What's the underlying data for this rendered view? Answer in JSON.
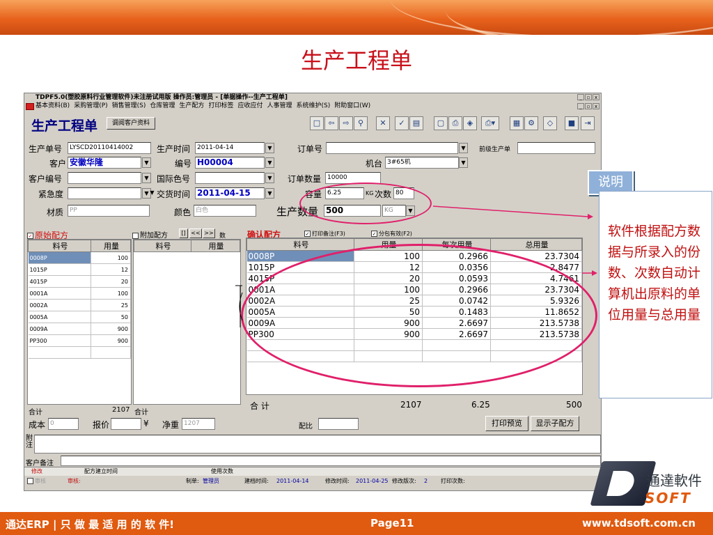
{
  "slide": {
    "title": "生产工程单",
    "footer_left": "通达ERP | 只 做 最 适 用 的 软 件!",
    "footer_page": "Page11",
    "footer_url": "www.tdsoft.com.cn",
    "logo_cn": "通達軟件",
    "logo_en": "SOFT",
    "note_tag": "说明",
    "note_text": "软件根据配方数据与所录入的份数、次数自动计算机出原料的单位用量与总用量",
    "color_accent": "#c8101a",
    "color_band": "#e05a0f"
  },
  "window": {
    "title": "TDPF5.0(塑胶原料行业管理软件)未注册试用版 操作员:管理员 - [单据操作--生产工程单]",
    "menus": [
      "基本资料(B)",
      "采购管理(P)",
      "销售管理(S)",
      "仓库管理",
      "生产配方",
      "打印标签",
      "应收应付",
      "人事管理",
      "系统维护(S)",
      "附助窗口(W)"
    ],
    "form_title": "生产工程单",
    "tool_button": "调阅客户资料",
    "toolbar_icons": [
      "new-icon",
      "prev-icon",
      "next-icon",
      "find-icon",
      "delete-icon",
      "confirm-icon",
      "clear-icon",
      "preview-icon",
      "print-setup-icon",
      "approve-icon",
      "printer-icon",
      "export-icon",
      "settings-icon",
      "tag-icon",
      "save-icon",
      "exit-icon"
    ]
  },
  "form": {
    "order_no_label": "生产单号",
    "order_no": "LYSCD20110414002",
    "time_label": "生产时间",
    "time": "2011-04-14",
    "po_label": "订单号",
    "po": "",
    "prev_label": "前级生产单",
    "prev": "",
    "customer_label": "客户",
    "customer": "安徽华隆",
    "code_label": "编号",
    "code": "H00004",
    "machine_label": "机台",
    "machine": "3#65机",
    "cust_no_label": "客户编号",
    "cust_no": "",
    "intl_color_label": "国际色号",
    "intl_color": "",
    "order_qty_label": "订单数量",
    "order_qty": "10000",
    "urgency_label": "紧急度",
    "urgency": "",
    "delivery_label": "交货时间",
    "delivery": "2011-04-15",
    "capacity_label": "容量",
    "capacity": "6.25",
    "capacity_unit": "KG",
    "times_label": "次数",
    "times": "80",
    "material_label": "材质",
    "material": "PP",
    "color_label": "颜色",
    "color": "白色",
    "qty_label": "生产数量",
    "qty": "500",
    "qty_unit": "KG"
  },
  "left": {
    "check_label": "原始配方",
    "headers": [
      "料号",
      "用量"
    ],
    "rows": [
      [
        "0008P",
        "100"
      ],
      [
        "1015P",
        "12"
      ],
      [
        "4015P",
        "20"
      ],
      [
        "0001A",
        "100"
      ],
      [
        "0002A",
        "25"
      ],
      [
        "0005A",
        "50"
      ],
      [
        "0009A",
        "900"
      ],
      [
        "PP300",
        "900"
      ]
    ],
    "total_label": "合计",
    "total": "2107"
  },
  "mid": {
    "check_label": "附加配方",
    "nav": [
      "[]",
      "<<",
      ">>",
      "数"
    ],
    "headers": [
      "料号",
      "用量"
    ],
    "total_label": "合计"
  },
  "right": {
    "label": "确认配方",
    "print_opt": "打印备注(F3)",
    "split_opt": "分包有效(F2)",
    "headers": [
      "料号",
      "用量",
      "每次用量",
      "总用量"
    ],
    "rows": [
      [
        "0008P",
        "100",
        "0.2966",
        "23.7304"
      ],
      [
        "1015P",
        "12",
        "0.0356",
        "2.8477"
      ],
      [
        "4015P",
        "20",
        "0.0593",
        "4.7461"
      ],
      [
        "0001A",
        "100",
        "0.2966",
        "23.7304"
      ],
      [
        "0002A",
        "25",
        "0.0742",
        "5.9326"
      ],
      [
        "0005A",
        "50",
        "0.1483",
        "11.8652"
      ],
      [
        "0009A",
        "900",
        "2.6697",
        "213.5738"
      ],
      [
        "PP300",
        "900",
        "2.6697",
        "213.5738"
      ]
    ],
    "total_label": "合 计",
    "total_qty": "2107",
    "total_each": "6.25",
    "total_all": "500"
  },
  "bottom": {
    "cost_label": "成本",
    "cost": "0",
    "quote_label": "报价",
    "yen": "¥",
    "net_label": "净重",
    "net": "1207",
    "ratio_label": "配比",
    "preview_btn": "打印预览",
    "sub_btn": "显示子配方",
    "remark_label": "附注",
    "cust_note_label": "客户备注",
    "log_headers": [
      "修改",
      "配方建立时间",
      "使用次数"
    ],
    "audit": "审核",
    "audit2": "审核:",
    "maker": "制单:",
    "maker_name": "管理员",
    "created_label": "建档时间:",
    "created": "2011-04-14",
    "modified_label": "修改时间:",
    "modified": "2011-04-25",
    "mod_count_label": "修改版次:",
    "mod_count": "2",
    "print_count_label": "打印次数:"
  }
}
